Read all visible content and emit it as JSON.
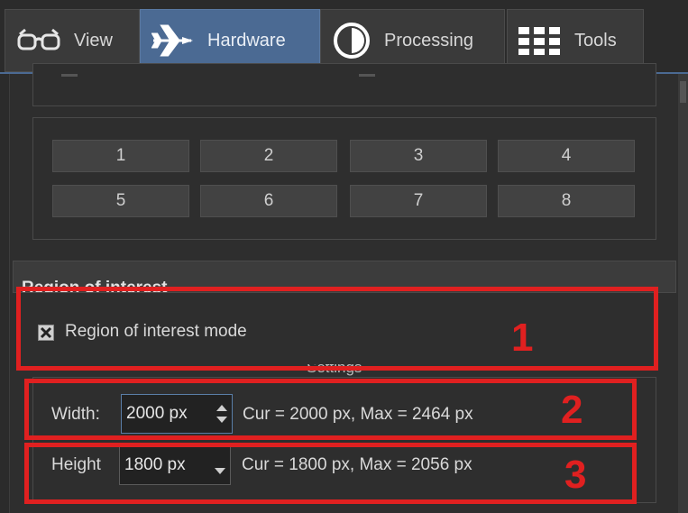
{
  "tabs": [
    {
      "label": "View",
      "icon": "glasses-icon",
      "active": false
    },
    {
      "label": "Hardware",
      "icon": "airplane-icon",
      "active": true
    },
    {
      "label": "Processing",
      "icon": "contrast-icon",
      "active": false
    },
    {
      "label": "Tools",
      "icon": "grid-icon",
      "active": false
    }
  ],
  "buttons": [
    "1",
    "2",
    "3",
    "4",
    "5",
    "6",
    "7",
    "8"
  ],
  "roi": {
    "header": "Region of interest",
    "mode_label": "Region of interest mode",
    "mode_checked": true,
    "settings_label": "Settings",
    "width_label": "Width:",
    "width_value": "2000 px",
    "width_info": "Cur = 2000 px,  Max = 2464 px",
    "height_label": "Height",
    "height_value": "1800 px",
    "height_info": "Cur = 1800 px,  Max = 2056 px"
  },
  "annotations": [
    "1",
    "2",
    "3"
  ],
  "colors": {
    "accent": "#4b6a93",
    "annotation": "#e02020",
    "background": "#2b2b2b"
  }
}
